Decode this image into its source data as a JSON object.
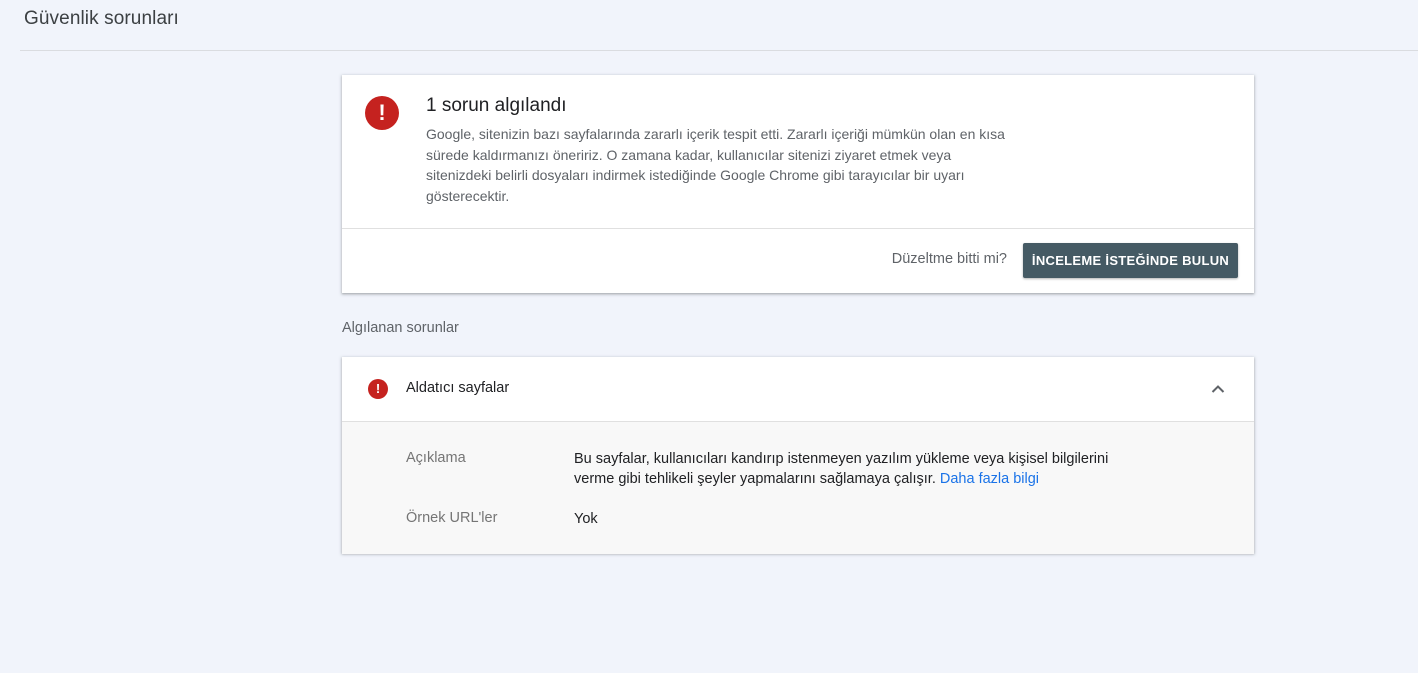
{
  "page": {
    "title": "Güvenlik sorunları"
  },
  "summary": {
    "icon": "error-icon",
    "title": "1 sorun algılandı",
    "description": "Google, sitenizin bazı sayfalarında zararlı içerik tespit etti. Zararlı içeriği mümkün olan en kısa sürede kaldırmanızı öneririz. O zamana kadar, kullanıcılar sitenizi ziyaret etmek veya sitenizdeki belirli dosyaları indirmek istediğinde Google Chrome gibi tarayıcılar bir uyarı gösterecektir.",
    "fix_question": "Düzeltme bitti mi?",
    "review_button_label": "İNCELEME İSTEĞİNDE BULUN"
  },
  "detected_section": {
    "label": "Algılanan sorunlar"
  },
  "issue": {
    "icon": "error-icon",
    "title": "Aldatıcı sayfalar",
    "expand_icon": "chevron-up-icon",
    "description_label": "Açıklama",
    "description_value": "Bu sayfalar, kullanıcıları kandırıp istenmeyen yazılım yükleme veya kişisel bilgilerini verme gibi tehlikeli şeyler yapmalarını sağlamaya çalışır.",
    "learn_more_link": "Daha fazla bilgi",
    "sample_urls_label": "Örnek URL'ler",
    "sample_urls_value": "Yok"
  },
  "colors": {
    "background": "#f1f4fb",
    "error": "#c5221f",
    "button": "#455a64",
    "link": "#1a73e8"
  }
}
